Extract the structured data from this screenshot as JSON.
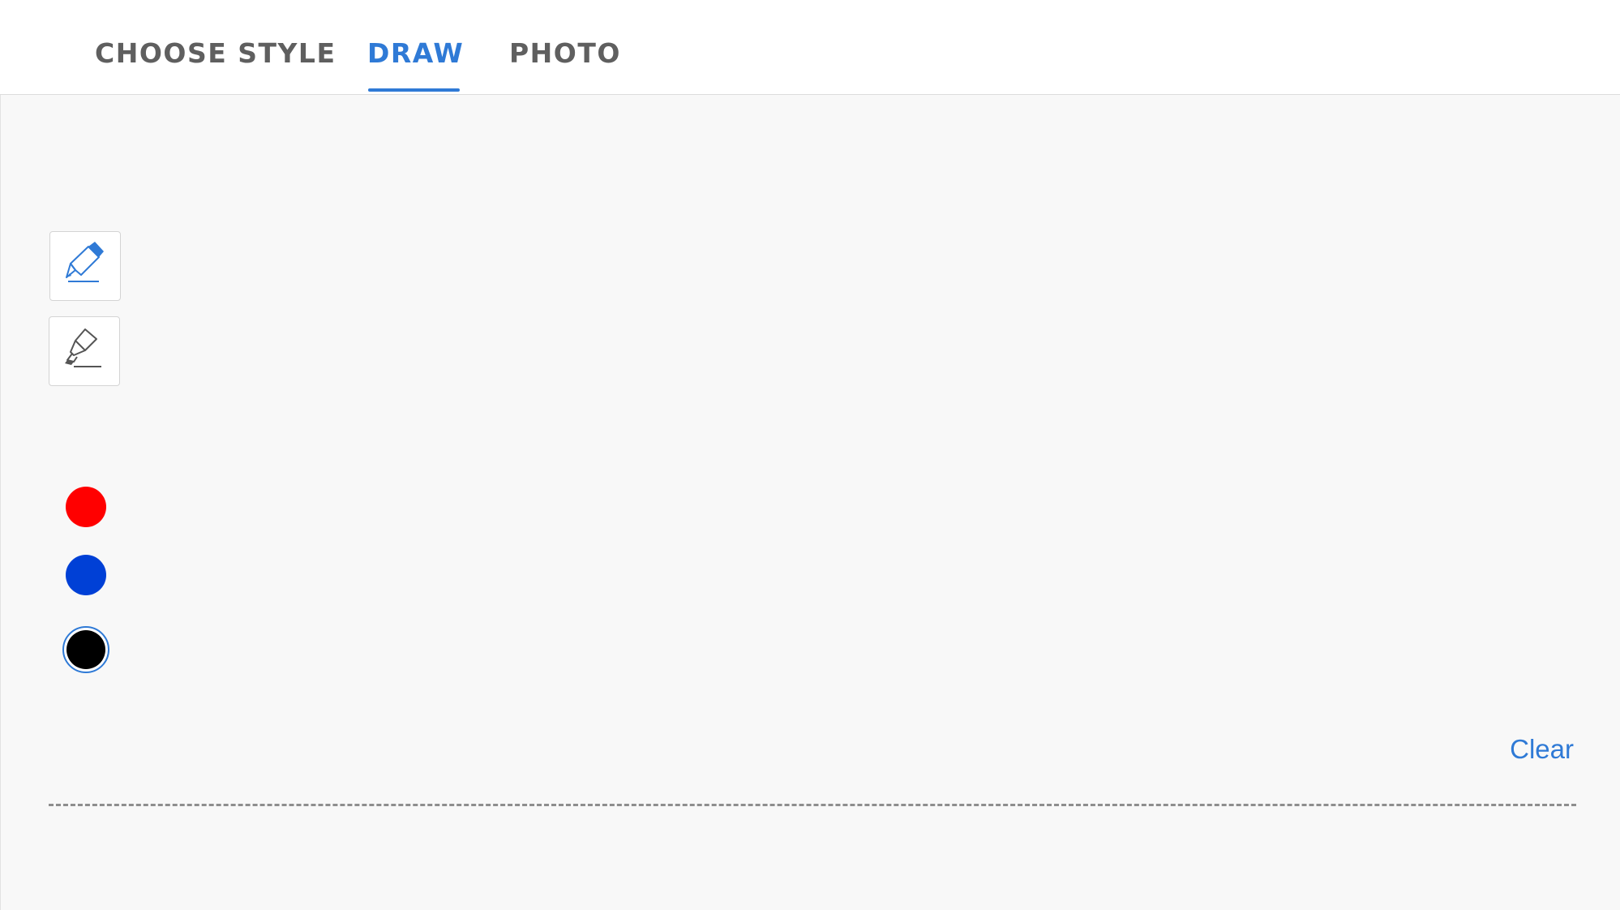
{
  "tabs": [
    {
      "label": "CHOOSE STYLE",
      "active": false
    },
    {
      "label": "DRAW",
      "active": true
    },
    {
      "label": "PHOTO",
      "active": false
    }
  ],
  "tools": [
    {
      "name": "pen",
      "icon": "pen-icon",
      "selected": true
    },
    {
      "name": "highlighter",
      "icon": "highlighter-icon",
      "selected": false
    }
  ],
  "colors": [
    {
      "name": "red",
      "hex": "#ff0000",
      "selected": false
    },
    {
      "name": "blue",
      "hex": "#0040d6",
      "selected": false
    },
    {
      "name": "black",
      "hex": "#000000",
      "selected": true
    }
  ],
  "actions": {
    "clear_label": "Clear"
  },
  "theme": {
    "accent": "#2f7ad6",
    "tab_inactive": "#5f5f5f",
    "canvas_bg": "#f8f8f8"
  }
}
